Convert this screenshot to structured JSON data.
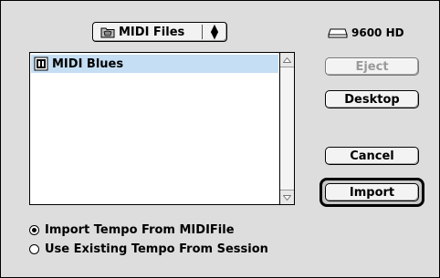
{
  "folder_popup": {
    "label": "MIDI Files",
    "icon": "folder-icon"
  },
  "volume": {
    "name": "9600 HD",
    "icon": "hard-disk-icon"
  },
  "file_list": {
    "items": [
      {
        "name": "MIDI Blues",
        "icon": "midi-document-icon",
        "selected": true
      }
    ]
  },
  "buttons": {
    "eject": "Eject",
    "desktop": "Desktop",
    "cancel": "Cancel",
    "import": "Import"
  },
  "options": {
    "items": [
      {
        "label": "Import Tempo From MIDIFile",
        "checked": true
      },
      {
        "label": "Use Existing Tempo From Session",
        "checked": false
      }
    ]
  },
  "colors": {
    "selection": "#c5def3",
    "dialog_bg": "#dddddd"
  }
}
